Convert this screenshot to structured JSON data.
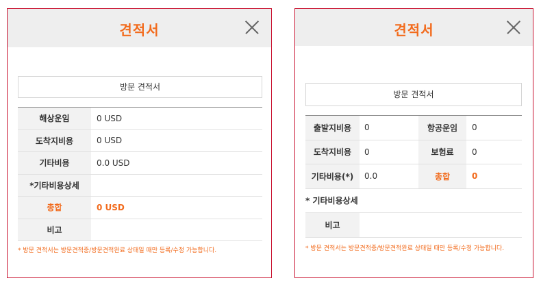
{
  "left": {
    "title": "견적서",
    "visit_estimate": "방문 견적서",
    "rows": [
      {
        "label": "해상운임",
        "value": "0 USD"
      },
      {
        "label": "도착지비용",
        "value": "0 USD"
      },
      {
        "label": "기타비용",
        "value": "0.0 USD"
      },
      {
        "label": "*기타비용상세",
        "value": ""
      },
      {
        "label": "총합",
        "value": "0 USD"
      },
      {
        "label": "비고",
        "value": ""
      }
    ],
    "note": "* 방문 견적서는 방문견적중/방문견적완료 상태일 때만 등록/수정 가능합니다."
  },
  "right": {
    "title": "견적서",
    "visit_estimate": "방문 견적서",
    "rows": [
      {
        "label": "출발지비용",
        "value": "0",
        "label2": "항공운임",
        "value2": "0"
      },
      {
        "label": "도착지비용",
        "value": "0",
        "label2": "보험료",
        "value2": "0"
      },
      {
        "label": "기타비용(*)",
        "value": "0.0",
        "label2": "총합",
        "value2": "0"
      }
    ],
    "detail_label": "* 기타비용상세",
    "remark_label": "비고",
    "remark_value": "",
    "note": "* 방문 견적서는 방문견적중/방문견적완료 상태일 때만 등록/수정 가능합니다."
  },
  "colors": {
    "accent": "#f26b1d",
    "border": "#c8102e",
    "header_bg": "#eeeeee",
    "label_bg": "#f2f2f2"
  }
}
